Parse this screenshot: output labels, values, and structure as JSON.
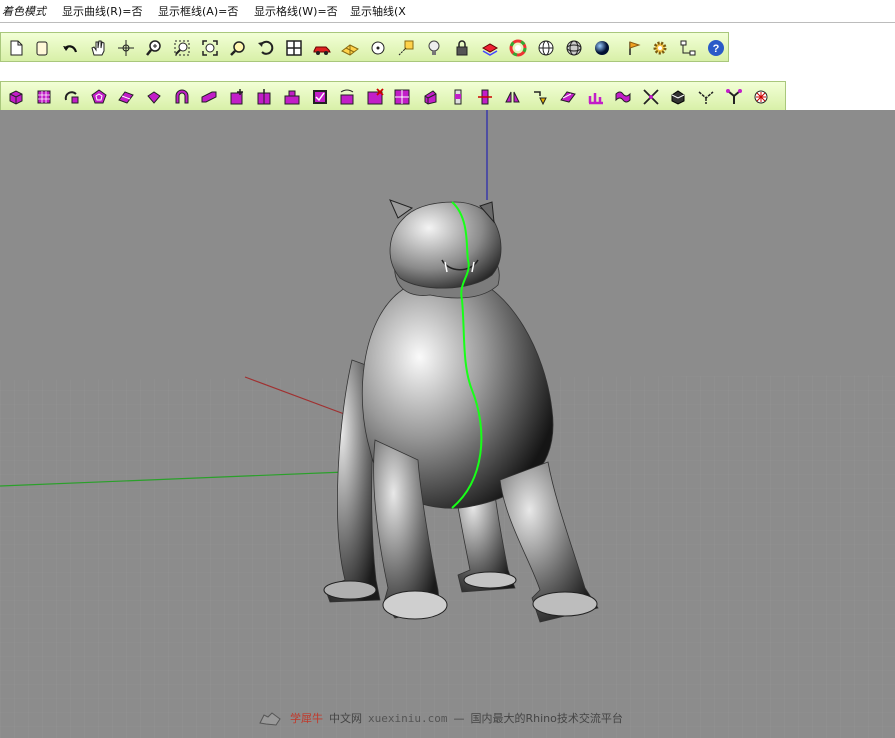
{
  "command_bar": {
    "items": [
      "着色模式",
      "显示曲线(R)=否",
      "显示框线(A)=否",
      "显示格线(W)=否",
      "显示轴线(X"
    ]
  },
  "toolbar_top": {
    "buttons": [
      "new-file",
      "open-file",
      "undo",
      "pan",
      "rotate-view",
      "zoom",
      "zoom-window",
      "zoom-extents",
      "zoom-selected",
      "undo-view",
      "four-viewports",
      "car-object",
      "plane-grid",
      "circle-snap",
      "point-snap",
      "lightbulb",
      "lock",
      "layer",
      "color-wheel",
      "wireframe-sphere",
      "mesh-sphere",
      "render-sphere",
      "flag",
      "settings",
      "tree-structure",
      "help"
    ]
  },
  "toolbar_bottom": {
    "buttons": [
      "box",
      "point-grid",
      "rotate-3d",
      "polygon",
      "surface",
      "twist",
      "arch",
      "fold",
      "cube-add",
      "cube-split",
      "cube-group",
      "checkbox-solid",
      "mesh-transform",
      "mesh-delete",
      "grid-solid",
      "extrude",
      "column",
      "column-red",
      "flip",
      "transform",
      "flat-surface",
      "ramp",
      "wave",
      "cross",
      "dice",
      "branch",
      "tree",
      "star-point"
    ],
    "accent": "#c21ec8"
  },
  "watermark": {
    "site_name": "学犀牛",
    "site_suffix": "中文网",
    "url": "xuexiniu.com",
    "separator": "—",
    "slogan": "国内最大的Rhino技术交流平台"
  },
  "colors": {
    "viewport_bg": "#8c8c8c",
    "toolbar_bg": "#e4f7c0",
    "seam_line": "#18ff18",
    "axis_x": "#a03030",
    "axis_y": "#2aa02a",
    "axis_z": "#3a3aa8"
  }
}
